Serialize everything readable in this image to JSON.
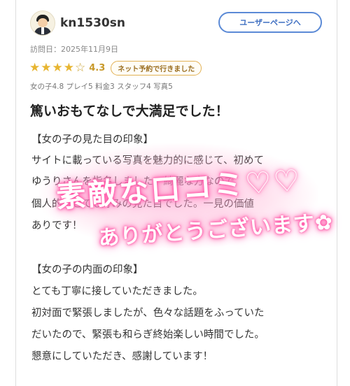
{
  "user": {
    "name": "kn1530sn",
    "avatar_icon": "businessman-avatar-icon"
  },
  "header": {
    "user_page_button": "ユーザーページへ"
  },
  "visit": {
    "date_label": "訪問日：2025年11月9日"
  },
  "rating": {
    "stars_filled": 4,
    "stars_total": 5,
    "score": "4.3",
    "tag": "ネット予約で行きました",
    "star_color": "#e7b531"
  },
  "sub_scores": "女の子4.8 プレイ5 料金3 スタッフ4 写真5",
  "review": {
    "title": "篤いおもてなしで大満足でした！",
    "lines": [
      "【女の子の見た目の印象】",
      "サイトに載っている写真を魅力的に感じて、初めて",
      "ゆうりさんを指名しました。綺麗な方なので",
      "個人的にとても好みの見た目でした。一見の価値",
      "ありです！",
      "",
      "【女の子の内面の印象】",
      "とても丁寧に接していただきました。",
      "初対面で緊張しましたが、色々な話題をふっていた",
      "だいたので、緊張も和らぎ終始楽しい時間でした。",
      "懇意にしていただき、感謝しています！"
    ]
  },
  "sticker": {
    "line1": "素敵な口コミ♡♡",
    "line2": "ありがとうございます✿",
    "glow_color": "#ff4fa3"
  }
}
